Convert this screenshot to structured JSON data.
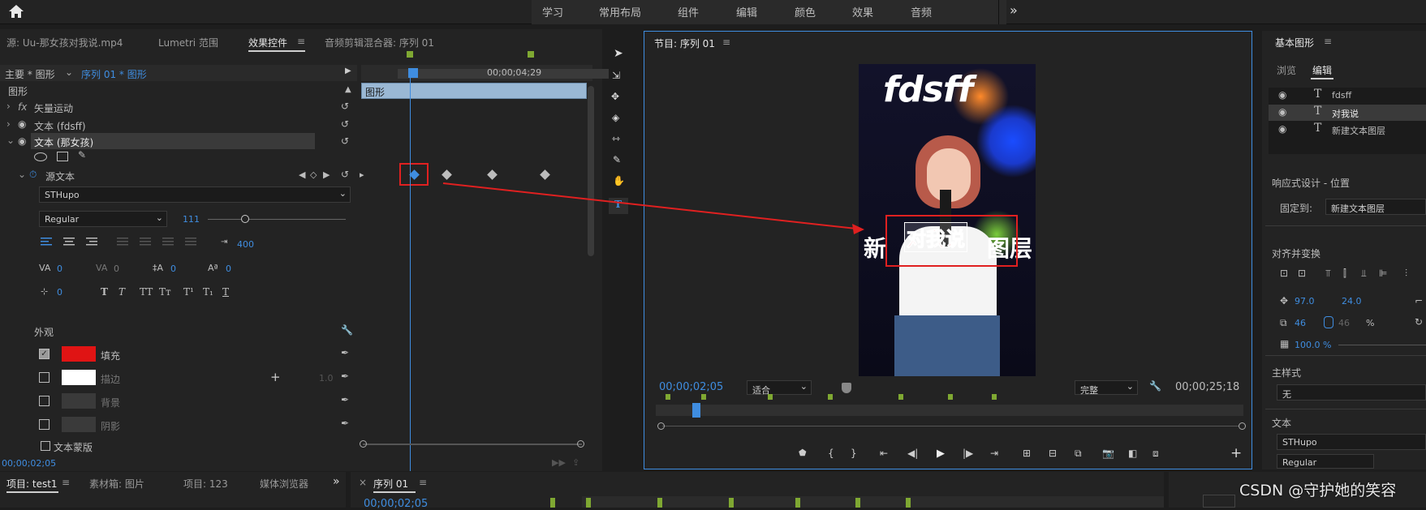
{
  "topbar": {
    "workspaces": [
      "学习",
      "常用布局",
      "组件",
      "编辑",
      "颜色",
      "效果",
      "音频"
    ],
    "more": "»"
  },
  "left_panel": {
    "tabs": [
      "源: Uu-那女孩对我说.mp4",
      "Lumetri 范围",
      "效果控件",
      "音频剪辑混合器: 序列 01"
    ],
    "tab_menu": "≡",
    "breadcrumb_main": "主要 * 图形",
    "breadcrumb_seq": "序列 01 * 图形",
    "section_graphic": "图形",
    "vector_motion": "矢量运动",
    "fx": "fx",
    "text1": "文本 (fdsff)",
    "text2": "文本 (那女孩)",
    "source_text": "源文本",
    "font": "STHupo",
    "font_style": "Regular",
    "font_size": "111",
    "tracking_right": "400",
    "kerning": "0",
    "tracking": "0",
    "leading": "0",
    "baseline": "0",
    "tsume": "0",
    "appearance": "外观",
    "fill": "填充",
    "stroke": "描边",
    "stroke_width": "1.0",
    "background": "背景",
    "shadow": "阴影",
    "text_mask": "文本蒙版",
    "time_label": "00;00;04;29",
    "timeline_clip": "图形",
    "bottom_time": "00;00;02;05",
    "typo_buttons": [
      "T",
      "T",
      "TT",
      "Tт",
      "T¹",
      "T₁",
      "T"
    ]
  },
  "tools": [
    "选择",
    "轨道选择",
    "波纹编辑",
    "剃刀",
    "滑动",
    "钢笔",
    "手形",
    "文字"
  ],
  "program": {
    "title": "节目: 序列 01",
    "tab_menu": "≡",
    "overlay_title": "fdsff",
    "overlay_banner_left": "新",
    "overlay_banner_right": "图层",
    "overlay_red": "对我说",
    "timecode": "00;00;02;05",
    "fit": "适合",
    "quality": "完整",
    "duration": "00;00;25;18"
  },
  "right_panel": {
    "title": "基本图形",
    "tab_menu": "≡",
    "tabs": [
      "浏览",
      "编辑"
    ],
    "layers": [
      "fdsff",
      "对我说",
      "新建文本图层"
    ],
    "responsive": "响应式设计 - 位置",
    "pin_label": "固定到:",
    "pin_value": "新建文本图层",
    "align": "对齐并变换",
    "pos_x": "97.0",
    "pos_y": "24.0",
    "scale_x": "46",
    "scale_y": "46",
    "pct": "%",
    "opacity": "100.0 %",
    "master_style": "主样式",
    "style_value": "无",
    "text_section": "文本",
    "font": "STHupo",
    "font_style": "Regular"
  },
  "bottom": {
    "project": "项目: test1",
    "bin": "素材箱: 图片",
    "project2": "项目: 123",
    "media_browser": "媒体浏览器",
    "sequence_tab": "序列 01",
    "seq_time": "00;00;02;05",
    "watermark": "CSDN @守护她的笑容"
  },
  "colors": {
    "accent": "#3f8de0",
    "fill_swatch": "#e01414",
    "stroke_swatch": "#ffffff",
    "red_box": "#e02020",
    "keyframe_blue": "#3f8de0"
  }
}
